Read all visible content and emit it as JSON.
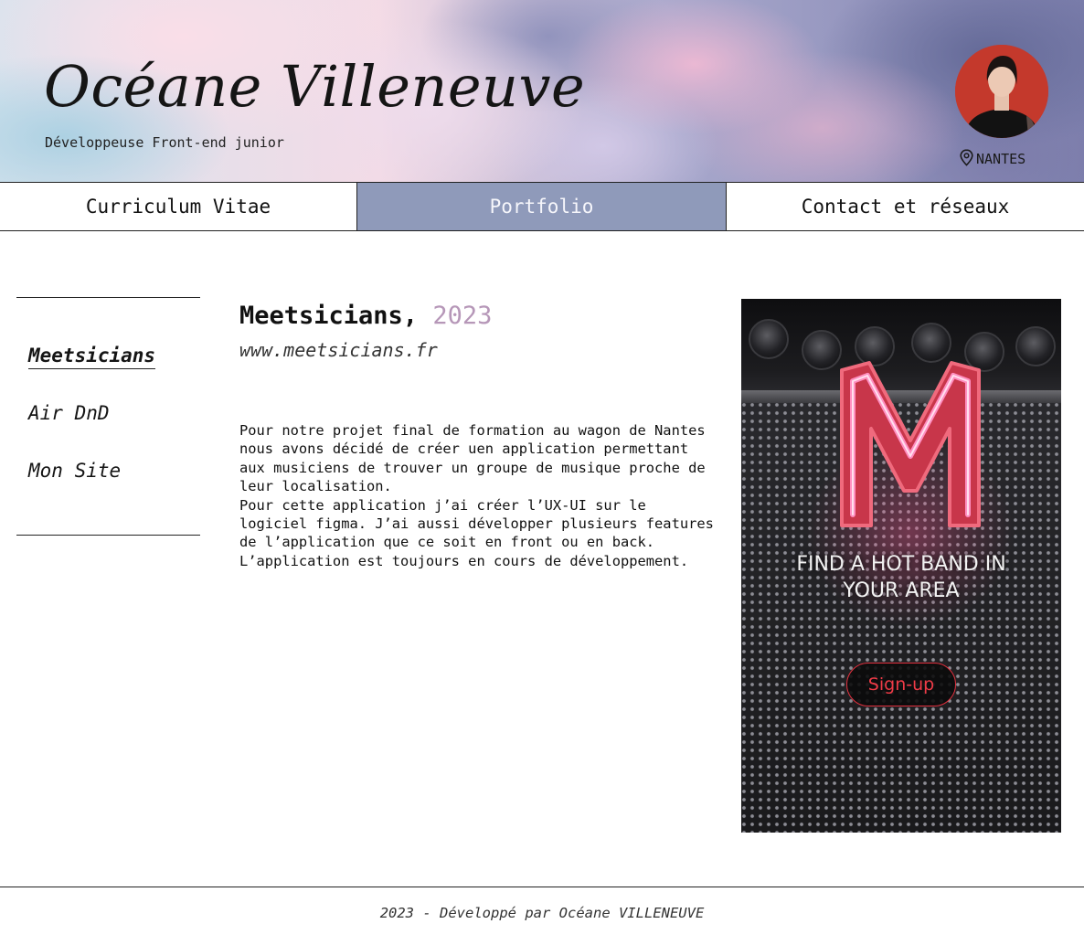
{
  "header": {
    "name": "Océane Villeneuve",
    "subtitle": "Développeuse Front-end junior",
    "location": "NANTES",
    "location_icon": "map-pin-icon"
  },
  "nav": {
    "tabs": [
      {
        "label": "Curriculum Vitae",
        "active": false
      },
      {
        "label": "Portfolio",
        "active": true
      },
      {
        "label": "Contact et réseaux",
        "active": false
      }
    ]
  },
  "sidebar": {
    "items": [
      {
        "label": "Meetsicians",
        "active": true
      },
      {
        "label": "Air DnD",
        "active": false
      },
      {
        "label": "Mon Site",
        "active": false
      }
    ]
  },
  "project": {
    "title": "Meetsicians,",
    "year": "2023",
    "url": "www.meetsicians.fr",
    "description": "Pour notre projet final de formation au wagon de Nantes\nnous avons décidé de créer uen application permettant\naux musiciens de trouver un groupe de musique proche de\nleur localisation.\nPour cette application j’ai créer l’UX-UI sur le\nlogiciel figma. J’ai aussi développer plusieurs features\nde l’application que ce soit en front ou en back.\nL’application est toujours en cours de développement."
  },
  "mockup": {
    "tagline": "FIND A HOT BAND IN\nYOUR AREA",
    "signup_label": "Sign-up"
  },
  "footer": {
    "text": "2023 - Développé par Océane VILLENEUVE"
  },
  "colors": {
    "nav_active_bg": "#8f9aba",
    "year_accent": "#b697b8",
    "signup_red": "#ef3b47",
    "neon_pink": "#ff4f8b"
  }
}
